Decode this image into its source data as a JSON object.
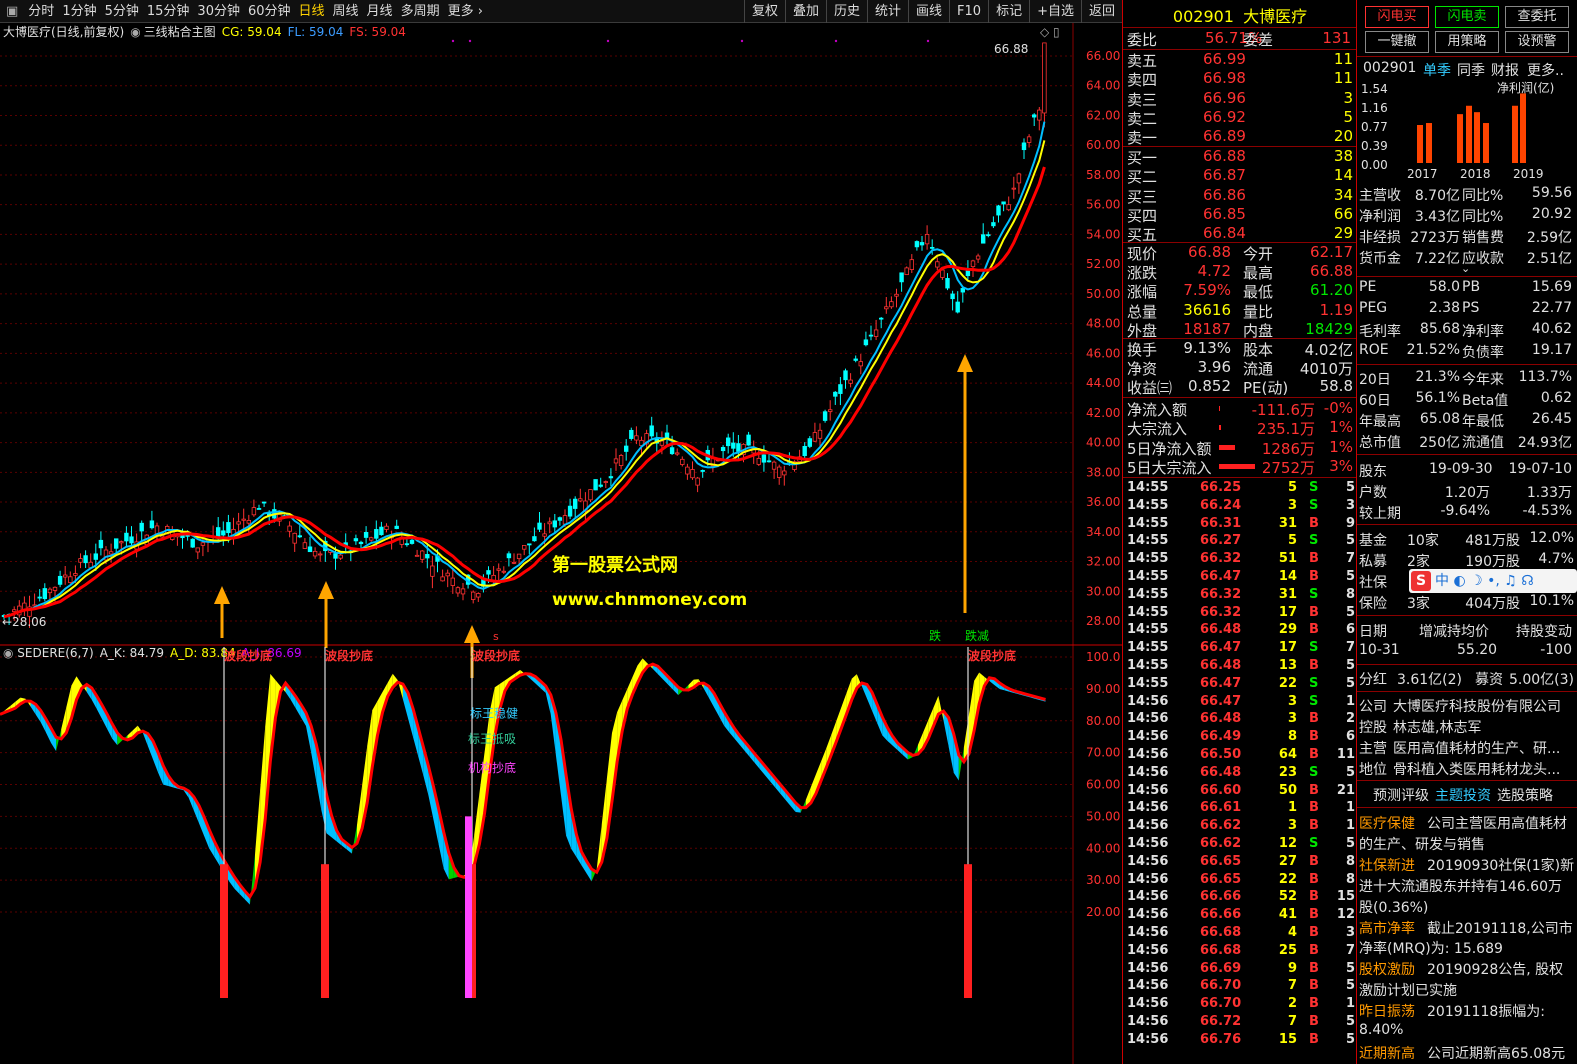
{
  "toolbar": {
    "left": [
      "分时",
      "1分钟",
      "5分钟",
      "15分钟",
      "30分钟",
      "60分钟",
      "日线",
      "周线",
      "月线",
      "多周期",
      "更多"
    ],
    "active": "日线",
    "right": [
      "复权",
      "叠加",
      "历史",
      "统计",
      "画线",
      "F10",
      "标记",
      "+自选",
      "返回"
    ]
  },
  "main": {
    "title": "大博医疗(日线,前复权)",
    "indicator": "三线粘合主图",
    "cg": "CG: 59.04",
    "fl": "FL: 59.04",
    "fs": "FS: 59.04",
    "hi_label": "66.88",
    "lo_label": "28.06",
    "watermark1": "第一股票公式网",
    "watermark2": "www.chnmoney.com",
    "y_ticks": [
      "66.00",
      "64.00",
      "62.00",
      "60.00",
      "58.00",
      "56.00",
      "54.00",
      "52.00",
      "50.00",
      "48.00",
      "46.00",
      "44.00",
      "42.00",
      "40.00",
      "38.00",
      "36.00",
      "34.00",
      "32.00",
      "30.00",
      "28.00"
    ],
    "tags": [
      "跌",
      "跌",
      "减"
    ]
  },
  "sub": {
    "title": "SEDERE(6,7)",
    "ak": "A_K: 84.79",
    "ad": "A_D: 83.84",
    "aj": "A_J: 86.69",
    "y_ticks": [
      "100.0",
      "90.00",
      "80.00",
      "70.00",
      "60.00",
      "50.00",
      "40.00",
      "30.00",
      "20.00"
    ],
    "label_bottom": "波段抄底",
    "label_b1": "标王稳健",
    "label_b2": "标王抵吸",
    "label_b3": "机构抄底"
  },
  "stock": {
    "code": "002901",
    "name": "大博医疗",
    "weibi_l": "委比",
    "weibi": "56.71%",
    "weicha_l": "委差",
    "weicha": "131"
  },
  "asks": [
    [
      "卖五",
      "66.99",
      "11"
    ],
    [
      "卖四",
      "66.98",
      "11"
    ],
    [
      "卖三",
      "66.96",
      "3"
    ],
    [
      "卖二",
      "66.92",
      "5"
    ],
    [
      "卖一",
      "66.89",
      "20"
    ]
  ],
  "bids": [
    [
      "买一",
      "66.88",
      "38"
    ],
    [
      "买二",
      "66.87",
      "14"
    ],
    [
      "买三",
      "66.86",
      "34"
    ],
    [
      "买四",
      "66.85",
      "66"
    ],
    [
      "买五",
      "66.84",
      "29"
    ]
  ],
  "stats": [
    [
      "现价",
      "66.88",
      "今开",
      "62.17"
    ],
    [
      "涨跌",
      "4.72",
      "最高",
      "66.88"
    ],
    [
      "涨幅",
      "7.59%",
      "最低",
      "61.20"
    ],
    [
      "总量",
      "36616",
      "量比",
      "1.19"
    ],
    [
      "外盘",
      "18187",
      "内盘",
      "18429"
    ]
  ],
  "stats2": [
    [
      "换手",
      "9.13%",
      "股本",
      "4.02亿"
    ],
    [
      "净资",
      "3.96",
      "流通",
      "4010万"
    ],
    [
      "收益㈢",
      "0.852",
      "PE(动)",
      "58.8"
    ]
  ],
  "flows": [
    [
      "净流入额",
      "-111.6万",
      "-0%"
    ],
    [
      "大宗流入",
      "235.1万",
      "1%"
    ],
    [
      "5日净流入额",
      "1286万",
      "1%"
    ],
    [
      "5日大宗流入",
      "2752万",
      "3%"
    ]
  ],
  "ticks": [
    [
      "14:55",
      "66.25",
      "5",
      "S",
      "5"
    ],
    [
      "14:55",
      "66.24",
      "3",
      "S",
      "3"
    ],
    [
      "14:55",
      "66.31",
      "31",
      "B",
      "9"
    ],
    [
      "14:55",
      "66.27",
      "5",
      "S",
      "5"
    ],
    [
      "14:55",
      "66.32",
      "51",
      "B",
      "7"
    ],
    [
      "14:55",
      "66.47",
      "14",
      "B",
      "5"
    ],
    [
      "14:55",
      "66.32",
      "31",
      "S",
      "8"
    ],
    [
      "14:55",
      "66.32",
      "17",
      "B",
      "5"
    ],
    [
      "14:55",
      "66.48",
      "29",
      "B",
      "6"
    ],
    [
      "14:55",
      "66.47",
      "17",
      "S",
      "7"
    ],
    [
      "14:55",
      "66.48",
      "13",
      "B",
      "5"
    ],
    [
      "14:55",
      "66.47",
      "22",
      "S",
      "5"
    ],
    [
      "14:56",
      "66.47",
      "3",
      "S",
      "1"
    ],
    [
      "14:56",
      "66.48",
      "3",
      "B",
      "2"
    ],
    [
      "14:56",
      "66.49",
      "8",
      "B",
      "6"
    ],
    [
      "14:56",
      "66.50",
      "64",
      "B",
      "11"
    ],
    [
      "14:56",
      "66.48",
      "23",
      "S",
      "5"
    ],
    [
      "14:56",
      "66.60",
      "50",
      "B",
      "21"
    ],
    [
      "14:56",
      "66.61",
      "1",
      "B",
      "1"
    ],
    [
      "14:56",
      "66.62",
      "3",
      "B",
      "1"
    ],
    [
      "14:56",
      "66.62",
      "12",
      "S",
      "5"
    ],
    [
      "14:56",
      "66.65",
      "27",
      "B",
      "8"
    ],
    [
      "14:56",
      "66.65",
      "22",
      "B",
      "8"
    ],
    [
      "14:56",
      "66.66",
      "52",
      "B",
      "15"
    ],
    [
      "14:56",
      "66.66",
      "41",
      "B",
      "12"
    ],
    [
      "14:56",
      "66.68",
      "4",
      "B",
      "3"
    ],
    [
      "14:56",
      "66.68",
      "25",
      "B",
      "7"
    ],
    [
      "14:56",
      "66.69",
      "9",
      "B",
      "5"
    ],
    [
      "14:56",
      "66.70",
      "7",
      "B",
      "5"
    ],
    [
      "14:56",
      "66.70",
      "2",
      "B",
      "1"
    ],
    [
      "14:56",
      "66.72",
      "7",
      "B",
      "5"
    ],
    [
      "14:56",
      "66.76",
      "15",
      "B",
      "5"
    ]
  ],
  "rbtns": [
    "闪电买",
    "闪电卖",
    "查委托",
    "一键撤",
    "用策略",
    "设预警"
  ],
  "rtabs": [
    "002901",
    "单季",
    "同季",
    "财报",
    "更多.."
  ],
  "bar": {
    "ylabel": "净利润(亿)",
    "yticks": [
      "1.54",
      "1.16",
      "0.77",
      "0.39",
      "0.00"
    ],
    "years": [
      "2017",
      "2018",
      "2019"
    ],
    "values": [
      0.77,
      0.81,
      0.99,
      1.16,
      1.03,
      0.81,
      1.16,
      1.41
    ]
  },
  "fin": [
    [
      "主营收",
      "8.70亿",
      "同比%",
      "59.56"
    ],
    [
      "净利润",
      "3.43亿",
      "同比%",
      "20.92"
    ],
    [
      "非经损",
      "2723万",
      "销售费",
      "2.59亿"
    ],
    [
      "货币金",
      "7.22亿",
      "应收款",
      "2.51亿"
    ]
  ],
  "val": [
    [
      "PE",
      "58.0",
      "PB",
      "15.69"
    ],
    [
      "PEG",
      "2.38",
      "PS",
      "22.77"
    ],
    [
      "毛利率",
      "85.68",
      "净利率",
      "40.62"
    ],
    [
      "ROE",
      "21.52%",
      "负债率",
      "19.17"
    ]
  ],
  "perf": [
    [
      "20日",
      "21.3%",
      "今年来",
      "113.7%"
    ],
    [
      "60日",
      "56.1%",
      "Beta值",
      "0.62"
    ],
    [
      "年最高",
      "65.08",
      "年最低",
      "26.45"
    ],
    [
      "总市值",
      "250亿",
      "流通值",
      "24.93亿"
    ]
  ],
  "holders": {
    "head": [
      "股东",
      "19-09-30",
      "19-07-10"
    ],
    "rows": [
      [
        "户数",
        "1.20万",
        "1.33万"
      ],
      [
        "较上期",
        "-9.64%",
        "-4.53%"
      ]
    ]
  },
  "funds": [
    [
      "基金",
      "10家",
      "481万股",
      "12.0%"
    ],
    [
      "私募",
      "2家",
      "190万股",
      "4.7%"
    ],
    [
      "社保",
      "",
      "",
      " "
    ],
    [
      "保险",
      "3家",
      "404万股",
      "10.1%"
    ]
  ],
  "ime": "中 ◐ ☽ •, ♫ ☊",
  "chg": {
    "head": [
      "日期",
      "增减持均价",
      "持股变动"
    ],
    "row": [
      "10-31",
      "55.20",
      "-100"
    ]
  },
  "div": [
    "分红",
    "3.61亿(2)",
    "募资",
    "5.00亿(3)"
  ],
  "info": [
    [
      "公司",
      "大博医疗科技股份有限公司"
    ],
    [
      "控股",
      "林志雄,林志军"
    ],
    [
      "主营",
      "医用高值耗材的生产、研..."
    ],
    [
      "地位",
      "骨科植入类医用耗材龙头..."
    ]
  ],
  "itabs": [
    "预测评级",
    "主题投资",
    "选股策略"
  ],
  "news": [
    [
      "医疗保健",
      "公司主营医用高值耗材"
    ],
    [
      "",
      "的生产、研发与销售"
    ],
    [
      "社保新进",
      "20190930社保(1家)新"
    ],
    [
      "",
      "进十大流通股东并持有146.60万"
    ],
    [
      "",
      "股(0.36%)"
    ],
    [
      "高市净率",
      "截止20191118,公司市"
    ],
    [
      "",
      "净率(MRQ)为: 15.689"
    ],
    [
      "股权激励",
      "20190928公告, 股权"
    ],
    [
      "",
      "激励计划已实施"
    ],
    [
      "昨日振荡",
      "20191118振幅为:"
    ],
    [
      "",
      "8.40%"
    ],
    [
      "近期新高",
      "公司近期新高65.08元"
    ]
  ],
  "colors": {
    "up": "#ff3232",
    "down": "#00ffff",
    "ma": "#ff0000",
    "yellow": "#ffff00",
    "blue": "#00bfff",
    "green": "#00d000",
    "magenta": "#ff44ff",
    "arrow": "#ffa500"
  }
}
